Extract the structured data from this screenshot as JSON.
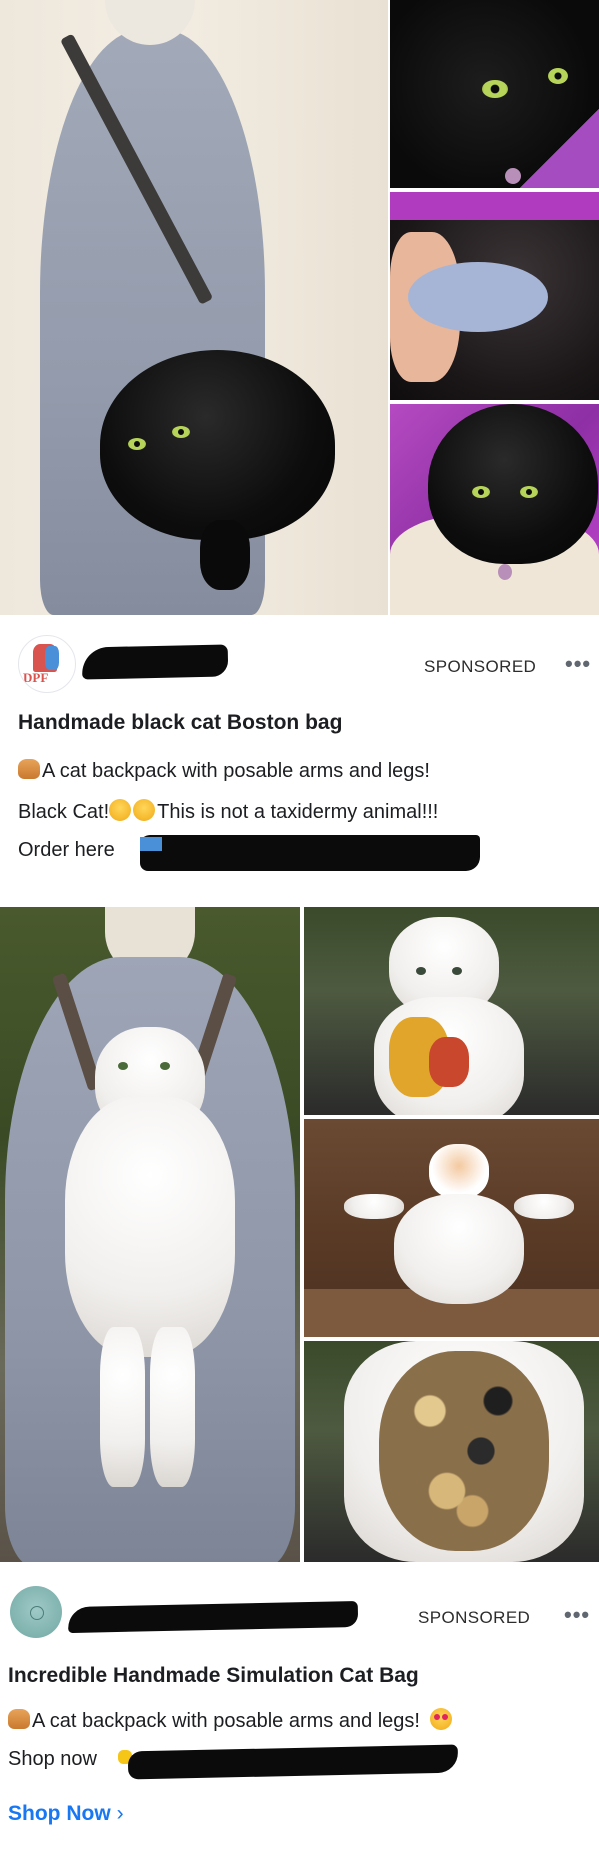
{
  "ad1": {
    "sponsored_label": "SPONSORED",
    "more_icon": "more-dots-icon",
    "title": "Handmade black cat Boston bag",
    "line1": "A cat backpack with posable arms and legs!",
    "line2_a": "Black Cat!",
    "line2_b": "This is not a taxidermy animal!!!",
    "line3": "Order here",
    "avatar_text": "DPF"
  },
  "ad2": {
    "sponsored_label": "SPONSORED",
    "more_icon": "more-dots-icon",
    "title": "Incredible Handmade Simulation Cat Bag",
    "line1": "A cat backpack with posable arms and legs!",
    "line2": "Shop now",
    "cta_label": "Shop Now",
    "cta_chevron": "›"
  },
  "colors": {
    "link_blue": "#1877f2",
    "text": "#1c1e21",
    "redaction": "#0b0b0b"
  }
}
